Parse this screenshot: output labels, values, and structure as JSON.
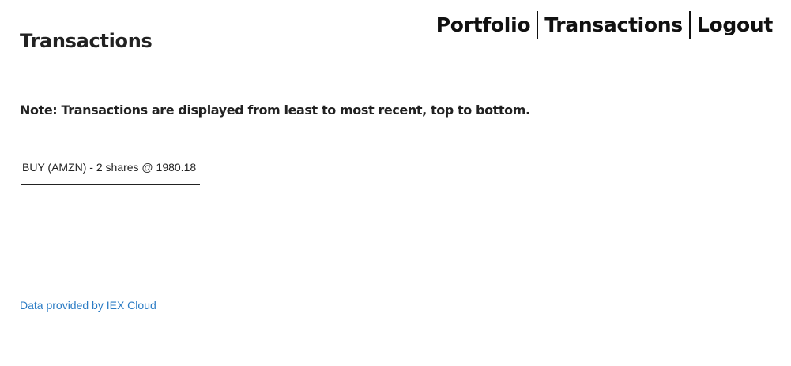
{
  "nav": {
    "items": [
      {
        "label": "Portfolio"
      },
      {
        "label": "Transactions"
      },
      {
        "label": "Logout"
      }
    ]
  },
  "page": {
    "title": "Transactions",
    "note": "Note: Transactions are displayed from least to most recent, top to bottom."
  },
  "transactions": [
    {
      "text": "BUY (AMZN) - 2 shares @ 1980.18"
    }
  ],
  "footer": {
    "attribution": "Data provided by IEX Cloud"
  },
  "colors": {
    "text": "#222222",
    "link": "#2a7bc4",
    "background": "#ffffff"
  }
}
